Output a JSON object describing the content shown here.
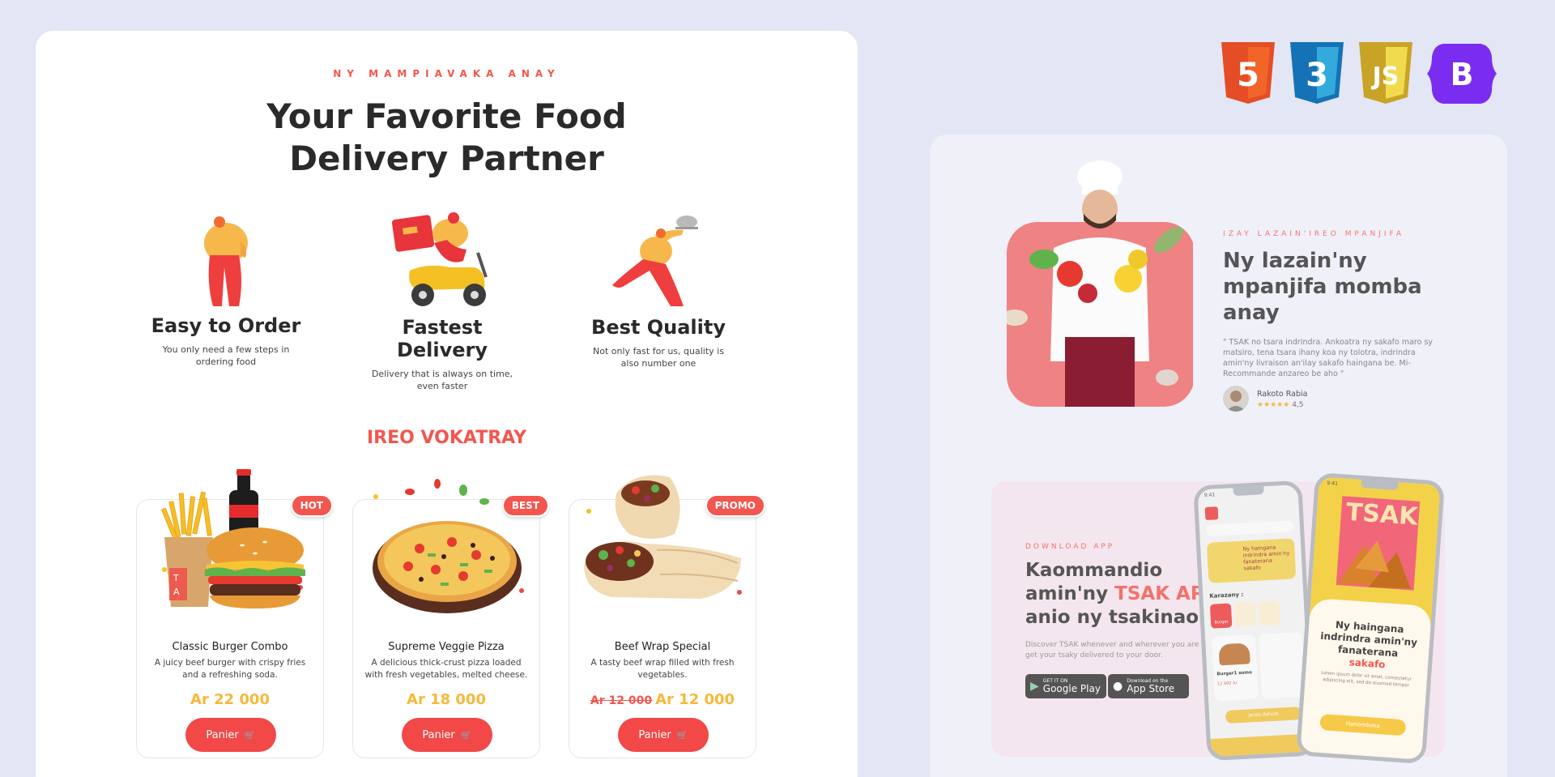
{
  "main": {
    "eyebrow": "NY MAMPIAVAKA ANAY",
    "headline_line1": "Your Favorite Food",
    "headline_line2": "Delivery Partner",
    "features": [
      {
        "title": "Easy to Order",
        "desc": "You only need a few steps in ordering food"
      },
      {
        "title": "Fastest Delivery",
        "desc": "Delivery that is always on time, even faster"
      },
      {
        "title": "Best Quality",
        "desc": "Not only fast for us, quality is also number one"
      }
    ],
    "section_title": "IREO VOKATRAY",
    "menu": [
      {
        "badge": "HOT",
        "name": "Classic Burger Combo",
        "desc": "A juicy beef burger with crispy fries and a refreshing soda.",
        "price": "Ar 22 000",
        "button": "Panier"
      },
      {
        "badge": "BEST",
        "name": "Supreme Veggie Pizza",
        "desc": "A delicious thick-crust pizza loaded with fresh vegetables, melted cheese.",
        "price": "Ar 18 000",
        "button": "Panier"
      },
      {
        "badge": "PROMO",
        "name": "Beef Wrap Special",
        "desc": "A tasty beef wrap filled with fresh vegetables.",
        "old_price": "Ar 12 000",
        "price": "Ar 12 000",
        "button": "Panier"
      }
    ],
    "burger_box_text": "T A"
  },
  "tech_icons": [
    {
      "label": "5",
      "icon": "html5-icon",
      "color": "#e44d26"
    },
    {
      "label": "3",
      "icon": "css3-icon",
      "color": "#1572b6"
    },
    {
      "label": "JS",
      "icon": "javascript-icon",
      "color": "#c9a326"
    },
    {
      "label": "B",
      "icon": "bootstrap-icon",
      "color": "#7a2df0"
    }
  ],
  "testimonial": {
    "eyebrow": "IZAY LAZAIN'IREO MPANJIFA",
    "title": "Ny lazain'ny mpanjifa momba anay",
    "quote": "\" TSAK no tsara indrindra. Ankoatra ny sakafo maro sy matsiro, tena tsara ihany koa ny tolotra, indrindra amin'ny livraison an'ilay sakafo haingana be. Mi-Recommande anzareo be aho \"",
    "reviewer": "Rakoto Rabia",
    "stars": "★★★★★",
    "rating": "4,5"
  },
  "app": {
    "eyebrow": "DOWNLOAD APP",
    "title_a": "Kaommandio amin'ny ",
    "title_hl": "TSAK APP",
    "title_b": " anio ny tsakinao",
    "desc": "Discover TSAK whenever and wherever you are and get your tsaky delivered to your door.",
    "google_small": "GET IT ON",
    "google_big": "Google Play",
    "apple_small": "Download on the",
    "apple_big": "App Store",
    "phone1": {
      "time": "9:41",
      "banner": "Ny haingana indrindra amin'ny fanaterana sakafo",
      "category_title": "Karazany :",
      "category": "Burger",
      "item": "Burger1 osmo",
      "item_price": "12 900 Ar",
      "cta": "Jereo daholo"
    },
    "phone2": {
      "time": "9:41",
      "logo": "TSAK",
      "text_a": "Ny haingana indrindra amin'ny fanaterana ",
      "text_hl": "sakafo",
      "lorem": "Lorem ipsum dolor sit amet, consectetur adipiscing elit, sed do eiusmod tempor",
      "cta": "Hanomboka"
    }
  },
  "colors": {
    "accent": "#f2564e",
    "price": "#f6b93b",
    "background": "#e3e6f4"
  }
}
